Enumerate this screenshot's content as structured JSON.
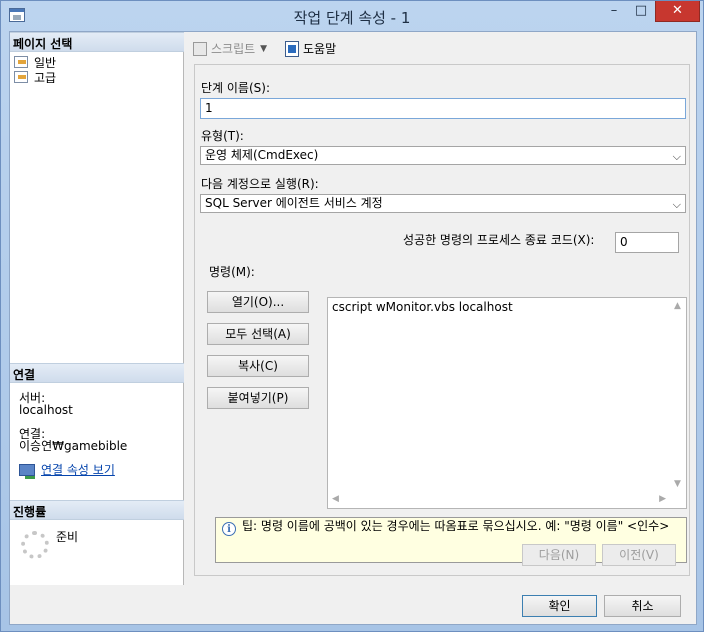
{
  "window": {
    "title": "작업 단계 속성 - 1",
    "minimize_glyph": "–",
    "maximize_glyph": "□",
    "close_glyph": "✕"
  },
  "sidebar": {
    "pages_header": "페이지 선택",
    "pages": [
      {
        "label": "일반",
        "icon": "page-icon"
      },
      {
        "label": "고급",
        "icon": "page-icon"
      }
    ],
    "connection_header": "연결",
    "server_label": "서버:",
    "server_value": "localhost",
    "connection_label": "연결:",
    "connection_value": "이승연₩gamebible",
    "view_connection_link": "연결 속성 보기",
    "progress_header": "진행률",
    "progress_status": "준비"
  },
  "toolbar": {
    "script_label": "스크립트",
    "help_label": "도움말"
  },
  "form": {
    "step_name_label": "단계 이름(S):",
    "step_name_value": "1",
    "type_label": "유형(T):",
    "type_value": "운영 체제(CmdExec)",
    "run_as_label": "다음 계정으로 실행(R):",
    "run_as_value": "SQL Server 에이전트 서비스 계정",
    "exit_code_label": "성공한 명령의 프로세스 종료 코드(X):",
    "exit_code_value": "0",
    "command_label": "명령(M):",
    "command_value": "cscript wMonitor.vbs localhost",
    "open_button": "열기(O)...",
    "select_all_button": "모두 선택(A)",
    "copy_button": "복사(C)",
    "paste_button": "붙여넣기(P)",
    "tip": "팁: 명령 이름에 공백이 있는 경우에는 따옴표로 묶으십시오. 예: \"명령 이름\" <인수>",
    "next_button": "다음(N)",
    "prev_button": "이전(V)"
  },
  "footer": {
    "ok_button": "확인",
    "cancel_button": "취소"
  }
}
